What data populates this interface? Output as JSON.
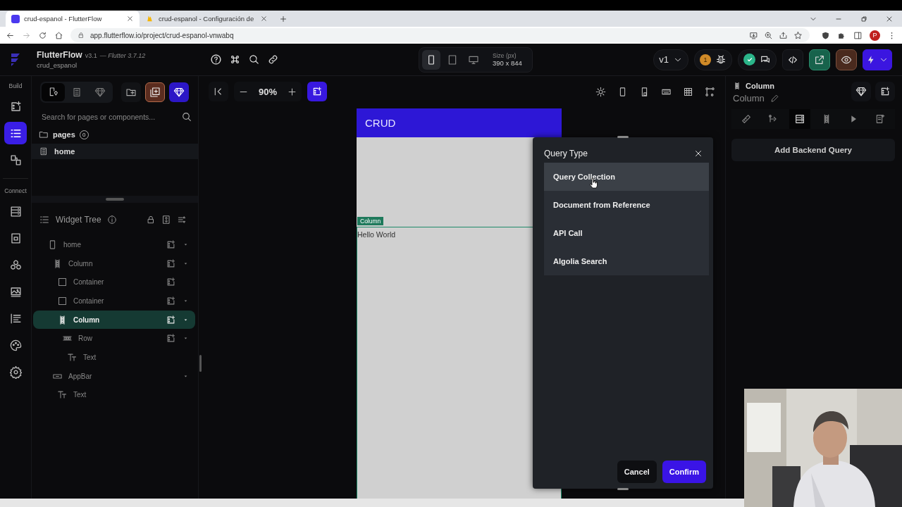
{
  "browser": {
    "tabs": [
      {
        "title": "crud-espanol - FlutterFlow",
        "selected": true
      },
      {
        "title": "crud-espanol - Configuración de",
        "selected": false
      }
    ],
    "url": "app.flutterflow.io/project/crud-espanol-vnwabq",
    "profile_initial": "P"
  },
  "header": {
    "brand": "FlutterFlow",
    "version": "v3.1",
    "flutter": "— Flutter 3.7.12",
    "project": "crud_espanol",
    "devices": [
      {
        "kind": "phone",
        "selected": true
      },
      {
        "kind": "tablet",
        "selected": false
      },
      {
        "kind": "desktop",
        "selected": false
      }
    ],
    "size_label": "Size (px)",
    "size_value": "390 x 844",
    "branch": "v1",
    "issue_count": "1"
  },
  "rail": {
    "sections": [
      {
        "label": "Build",
        "items": [
          {
            "kind": "add-widget",
            "selected": false
          },
          {
            "kind": "tree",
            "selected": true
          },
          {
            "kind": "connect",
            "selected": false
          }
        ]
      },
      {
        "label": "Connect",
        "items": [
          {
            "kind": "database",
            "selected": false
          },
          {
            "kind": "storage",
            "selected": false
          },
          {
            "kind": "cluster",
            "selected": false
          },
          {
            "kind": "media",
            "selected": false
          },
          {
            "kind": "text-align",
            "selected": false
          },
          {
            "kind": "palette",
            "selected": false
          },
          {
            "kind": "settings",
            "selected": false
          }
        ]
      }
    ]
  },
  "left_panel": {
    "tabs": [
      {
        "kind": "file-gem",
        "selected": true
      },
      {
        "kind": "pages",
        "selected": false
      },
      {
        "kind": "gem",
        "selected": false
      }
    ],
    "search_placeholder": "Search for pages or components...",
    "folder": {
      "label": "pages",
      "count": "0"
    },
    "pages": [
      {
        "name": "home",
        "selected": true
      }
    ]
  },
  "widget_tree": {
    "title": "Widget Tree",
    "nodes": [
      {
        "label": "home",
        "kind": "phone",
        "selected": false,
        "can_add": true,
        "has_menu": true,
        "children": [
          {
            "label": "Column",
            "kind": "column",
            "selected": false,
            "can_add": true,
            "has_menu": true,
            "children": [
              {
                "label": "Container",
                "kind": "container",
                "selected": false,
                "can_add": true,
                "has_menu": false
              },
              {
                "label": "Container",
                "kind": "container",
                "selected": false,
                "can_add": true,
                "has_menu": true
              },
              {
                "label": "Column",
                "kind": "column",
                "selected": true,
                "can_add": true,
                "has_menu": true,
                "children": [
                  {
                    "label": "Row",
                    "kind": "row",
                    "selected": false,
                    "can_add": true,
                    "has_menu": true,
                    "children": [
                      {
                        "label": "Text",
                        "kind": "text-type",
                        "selected": false,
                        "can_add": false,
                        "has_menu": false
                      }
                    ]
                  }
                ]
              }
            ]
          },
          {
            "label": "AppBar",
            "kind": "appbar",
            "selected": false,
            "can_add": false,
            "has_menu": true,
            "children": [
              {
                "label": "Text",
                "kind": "text-type",
                "selected": false,
                "can_add": false,
                "has_menu": false
              }
            ]
          }
        ]
      }
    ]
  },
  "canvas": {
    "zoom": "90%",
    "app_title": "CRUD",
    "selected_widget_tag": "Column",
    "text": "Hello World"
  },
  "query_dialog": {
    "title": "Query Type",
    "options": [
      {
        "label": "Query Collection",
        "selected": true
      },
      {
        "label": "Document from Reference",
        "selected": false
      },
      {
        "label": "API Call",
        "selected": false
      },
      {
        "label": "Algolia Search",
        "selected": false
      }
    ],
    "cancel": "Cancel",
    "confirm": "Confirm"
  },
  "properties": {
    "widget_type": "Column",
    "widget_name": "Column",
    "tabs": [
      {
        "kind": "style",
        "selected": false
      },
      {
        "kind": "actions",
        "selected": false
      },
      {
        "kind": "database",
        "selected": true
      },
      {
        "kind": "column",
        "selected": false
      },
      {
        "kind": "animation",
        "selected": false
      },
      {
        "kind": "docs",
        "selected": false
      }
    ],
    "add_query": "Add Backend Query"
  }
}
